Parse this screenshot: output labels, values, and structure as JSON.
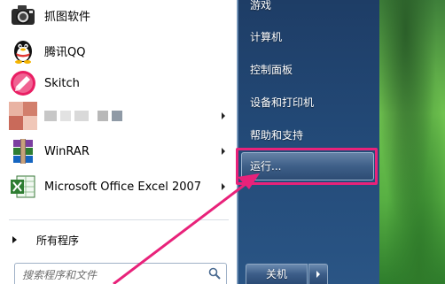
{
  "start_menu": {
    "programs": [
      {
        "label": "抓图软件",
        "icon": "camera-icon",
        "has_submenu": false
      },
      {
        "label": "腾讯QQ",
        "icon": "qq-penguin-icon",
        "has_submenu": false
      },
      {
        "label": "Skitch",
        "icon": "skitch-icon",
        "has_submenu": false
      },
      {
        "label": "",
        "icon": "blurred-app-icon",
        "has_submenu": true
      },
      {
        "label": "WinRAR",
        "icon": "winrar-icon",
        "has_submenu": true
      },
      {
        "label": "Microsoft Office Excel 2007",
        "icon": "excel-icon",
        "has_submenu": true
      }
    ],
    "all_programs_label": "所有程序",
    "search": {
      "placeholder": "搜索程序和文件",
      "value": ""
    },
    "right_items": {
      "games": "游戏",
      "computer": "计算机",
      "control_panel": "控制面板",
      "devices_printers": "设备和打印机",
      "help_support": "帮助和支持",
      "run": "运行..."
    },
    "shutdown_label": "关机"
  },
  "colors": {
    "highlight_outline": "#e8227a",
    "right_panel": "#234a78",
    "left_panel": "#ffffff"
  }
}
